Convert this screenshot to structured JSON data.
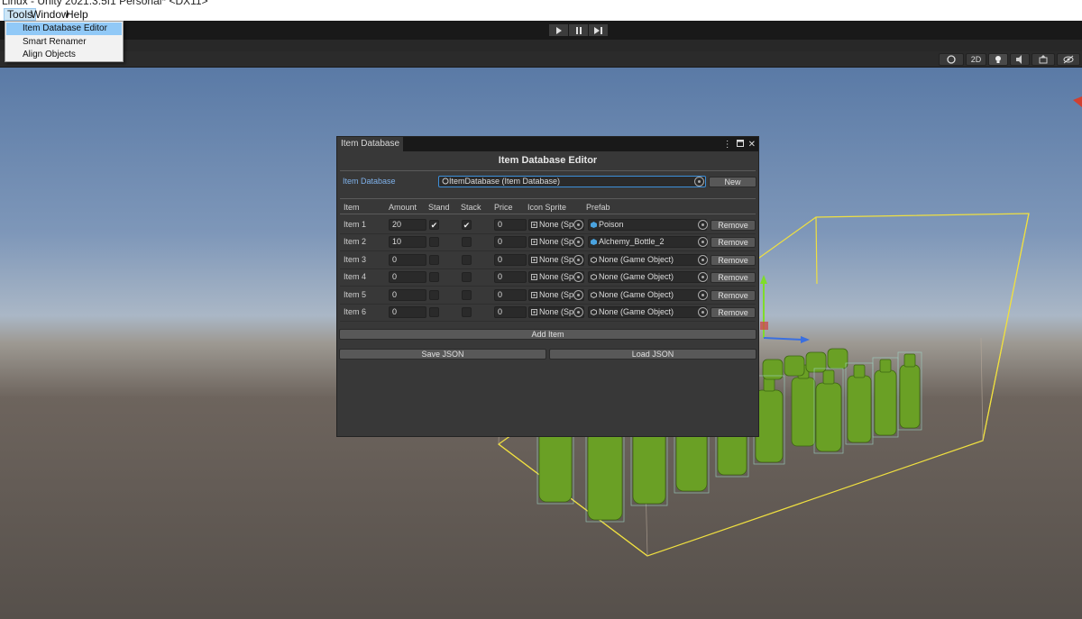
{
  "window_title": "Linux - Unity 2021.3.5f1 Personal* <DX11>",
  "menu": {
    "items": [
      {
        "label": "Tools",
        "active": true
      },
      {
        "label": "Window",
        "active": false
      },
      {
        "label": "Help",
        "active": false
      }
    ],
    "tools_dropdown": [
      "Item Database Editor",
      "Smart Renamer",
      "Align Objects"
    ]
  },
  "scene_toolbar": {
    "mode_2d": "2D"
  },
  "editor": {
    "tab_label": "Item Database",
    "title": "Item Database Editor",
    "db_label": "Item Database",
    "db_value": "ItemDatabase (Item Database)",
    "new_label": "New",
    "columns": [
      "Item",
      "Amount",
      "Stand",
      "Stack",
      "Price",
      "Icon Sprite",
      "Prefab"
    ],
    "rows": [
      {
        "label": "Item 1",
        "amount": "20",
        "stand": true,
        "stack": true,
        "price": "0",
        "icon": "None (Sp",
        "prefab": "Poison",
        "prefab_set": true
      },
      {
        "label": "Item 2",
        "amount": "10",
        "stand": false,
        "stack": false,
        "price": "0",
        "icon": "None (Sp",
        "prefab": "Alchemy_Bottle_2",
        "prefab_set": true
      },
      {
        "label": "Item 3",
        "amount": "0",
        "stand": false,
        "stack": false,
        "price": "0",
        "icon": "None (Sp",
        "prefab": "None (Game Object)",
        "prefab_set": false
      },
      {
        "label": "Item 4",
        "amount": "0",
        "stand": false,
        "stack": false,
        "price": "0",
        "icon": "None (Sp",
        "prefab": "None (Game Object)",
        "prefab_set": false
      },
      {
        "label": "Item 5",
        "amount": "0",
        "stand": false,
        "stack": false,
        "price": "0",
        "icon": "None (Sp",
        "prefab": "None (Game Object)",
        "prefab_set": false
      },
      {
        "label": "Item 6",
        "amount": "0",
        "stand": false,
        "stack": false,
        "price": "0",
        "icon": "None (Sp",
        "prefab": "None (Game Object)",
        "prefab_set": false
      }
    ],
    "remove_label": "Remove",
    "add_item_label": "Add Item",
    "save_json_label": "Save JSON",
    "load_json_label": "Load JSON"
  },
  "colors": {
    "accent_blue": "#7fb1ea",
    "selection_outline": "#f0e040",
    "bottle_green": "#6aa025"
  }
}
